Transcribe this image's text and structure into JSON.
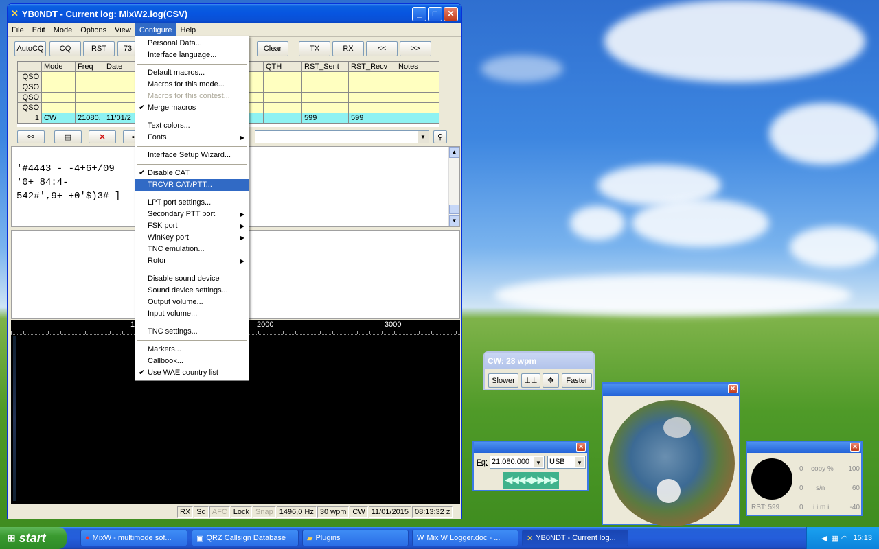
{
  "window": {
    "title": "YB0NDT - Current log: MixW2.log(CSV)"
  },
  "menubar": [
    "File",
    "Edit",
    "Mode",
    "Options",
    "View",
    "Configure",
    "Help"
  ],
  "toolbar": {
    "autocq": "AutoCQ",
    "cq": "CQ",
    "rst": "RST",
    "n73": "73",
    "clear": "Clear",
    "tx": "TX",
    "rx": "RX",
    "prev": "<<",
    "next": ">>"
  },
  "log": {
    "headers": [
      "",
      "Mode",
      "Freq",
      "Date",
      "",
      "",
      "QTH",
      "RST_Sent",
      "RST_Recv",
      "Notes"
    ],
    "rows": [
      [
        "QSO",
        "",
        "",
        "",
        "",
        "",
        "",
        "",
        "",
        ""
      ],
      [
        "QSO",
        "",
        "",
        "",
        "",
        "",
        "",
        "",
        "",
        ""
      ],
      [
        "QSO",
        "",
        "",
        "",
        "",
        "",
        "",
        "",
        "",
        ""
      ],
      [
        "QSO",
        "",
        "",
        "",
        "",
        "",
        "",
        "",
        "",
        ""
      ],
      [
        "1",
        "CW",
        "21080,",
        "11/01/2",
        "",
        "",
        "",
        "599",
        "599",
        ""
      ]
    ]
  },
  "rx_text": [
    "'#4443 - -4+6+/09",
    "'0+ 84:4-",
    "542#',9+ +0'$)3# ]"
  ],
  "waterfall": {
    "scale": [
      "1",
      "2000",
      "3000"
    ]
  },
  "configure_menu": [
    {
      "label": "Personal Data..."
    },
    {
      "label": "Interface language..."
    },
    {
      "sep": true
    },
    {
      "label": "Default macros..."
    },
    {
      "label": "Macros for this mode..."
    },
    {
      "label": "Macros for this contest...",
      "disabled": true
    },
    {
      "label": "Merge macros",
      "checked": true
    },
    {
      "sep": true
    },
    {
      "label": "Text colors..."
    },
    {
      "label": "Fonts",
      "sub": true
    },
    {
      "sep": true
    },
    {
      "label": "Interface Setup Wizard..."
    },
    {
      "sep": true
    },
    {
      "label": "Disable CAT",
      "checked": true
    },
    {
      "label": "TRCVR CAT/PTT...",
      "selected": true
    },
    {
      "sep": true
    },
    {
      "label": "LPT port settings..."
    },
    {
      "label": "Secondary PTT port",
      "sub": true
    },
    {
      "label": "FSK port",
      "sub": true
    },
    {
      "label": "WinKey port",
      "sub": true
    },
    {
      "label": "TNC emulation..."
    },
    {
      "label": "Rotor",
      "sub": true
    },
    {
      "sep": true
    },
    {
      "label": "Disable sound device"
    },
    {
      "label": "Sound device settings..."
    },
    {
      "label": "Output volume..."
    },
    {
      "label": "Input volume..."
    },
    {
      "sep": true
    },
    {
      "label": "TNC settings..."
    },
    {
      "sep": true
    },
    {
      "label": "Markers..."
    },
    {
      "label": "Callbook..."
    },
    {
      "label": "Use WAE country list",
      "checked": true
    }
  ],
  "statusbar": [
    "RX",
    "Sq",
    "AFC",
    "Lock",
    "Snap",
    "1496,0 Hz",
    "30 wpm",
    "CW",
    "11/01/2015",
    "08:13:32 z"
  ],
  "cw": {
    "title": "CW: 28 wpm",
    "slower": "Slower",
    "faster": "Faster"
  },
  "freq": {
    "label": "Fq:",
    "value": "21.080.000",
    "mode": "USB"
  },
  "meter": {
    "rows": [
      {
        "left": "0",
        "label": "copy %",
        "right": "100"
      },
      {
        "left": "0",
        "label": "s/n",
        "right": "60"
      },
      {
        "left": "0",
        "label": "i  i  m  i",
        "right": "-40"
      }
    ],
    "rst": "RST: 599"
  },
  "taskbar": {
    "start": "start",
    "tasks": [
      "MixW - multimode sof...",
      "QRZ Callsign Database",
      "Plugins",
      "Mix W  Logger.doc - ...",
      "YB0NDT - Current log..."
    ],
    "clock": "15:13"
  },
  "colors": {
    "grid_empty": "#ffffc0",
    "grid_row": "#8ef2f2",
    "selection": "#316ac5"
  }
}
